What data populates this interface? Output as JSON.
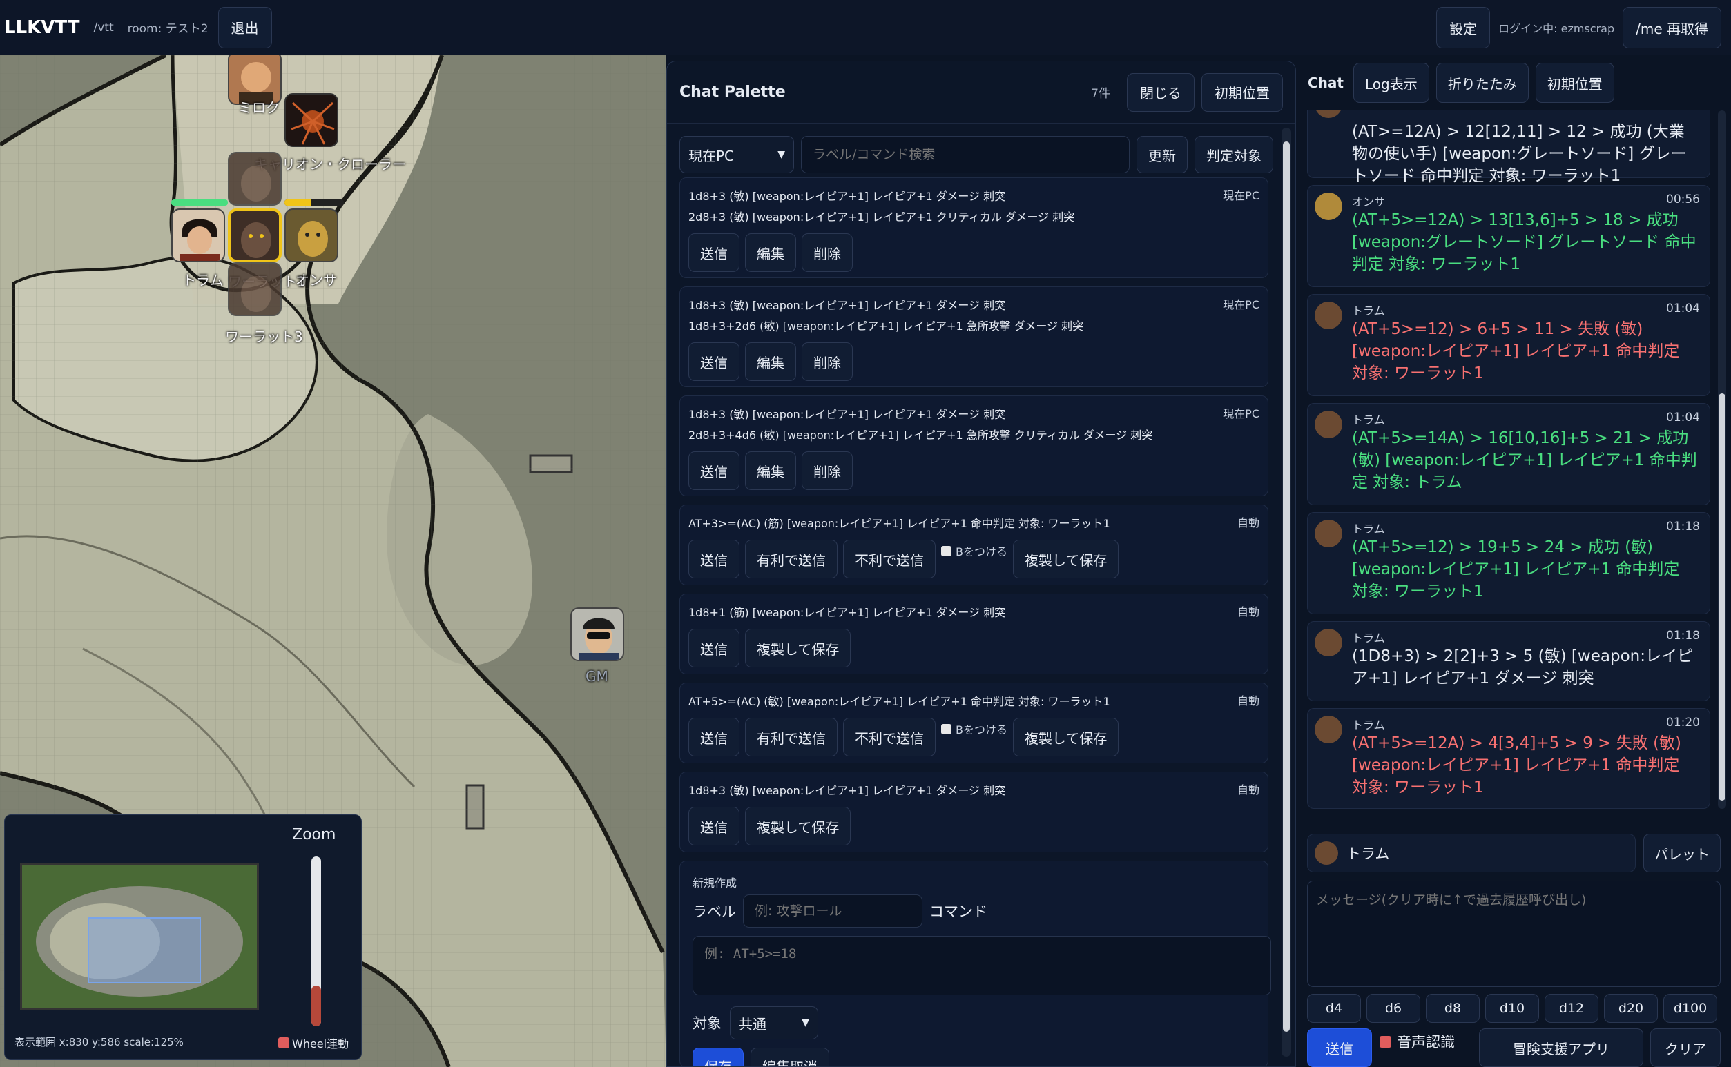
{
  "topbar": {
    "app_title": "LLKVTT",
    "path": "/vtt",
    "room": "room: テスト2",
    "logout": "退出",
    "settings": "設定",
    "login_status": "ログイン中: ezmscrap",
    "me_refresh": "/me 再取得"
  },
  "map": {
    "tokens": [
      {
        "name": "ミロク"
      },
      {
        "name": "キャリオン・クローラー"
      },
      {
        "name": "トラム"
      },
      {
        "name": "ワーラット1"
      },
      {
        "name": "オンサ"
      },
      {
        "name": "ワーラット3"
      },
      {
        "name": "GM"
      }
    ]
  },
  "minimap": {
    "zoom_label": "Zoom",
    "view_range": "表示範囲 x:830 y:586 scale:125%",
    "wheel_link": "Wheel連動",
    "zoom_level": 0.12
  },
  "palette": {
    "title": "Chat Palette",
    "count": "7件",
    "close": "閉じる",
    "reset_pos": "初期位置",
    "pc_select": "現在PC",
    "search_placeholder": "ラベル/コマンド検索",
    "refresh": "更新",
    "judge_target": "判定対象",
    "items": [
      {
        "line1": "1d8+3 (敏) [weapon:レイピア+1] レイピア+1 ダメージ 刺突",
        "line2": "2d8+3 (敏) [weapon:レイピア+1] レイピア+1 クリティカル ダメージ 刺突",
        "tag": "現在PC",
        "b1": "送信",
        "b2": "編集",
        "b3": "削除"
      },
      {
        "line1": "1d8+3 (敏) [weapon:レイピア+1] レイピア+1 ダメージ 刺突",
        "line2": "1d8+3+2d6 (敏) [weapon:レイピア+1] レイピア+1 急所攻撃 ダメージ 刺突",
        "tag": "現在PC",
        "b1": "送信",
        "b2": "編集",
        "b3": "削除"
      },
      {
        "line1": "1d8+3 (敏) [weapon:レイピア+1] レイピア+1 ダメージ 刺突",
        "line2": "2d8+3+4d6 (敏) [weapon:レイピア+1] レイピア+1 急所攻撃 クリティカル ダメージ 刺突",
        "tag": "現在PC",
        "b1": "送信",
        "b2": "編集",
        "b3": "削除"
      },
      {
        "line1": "AT+3>=(AC) (筋) [weapon:レイピア+1] レイピア+1 命中判定 対象: ワーラット1",
        "tag": "自動",
        "b1": "送信",
        "b2": "有利で送信",
        "b3": "不利で送信",
        "chk": "Bをつける",
        "b4": "複製して保存"
      },
      {
        "line1": "1d8+1 (筋) [weapon:レイピア+1] レイピア+1 ダメージ 刺突",
        "tag": "自動",
        "b1": "送信",
        "b2": "複製して保存"
      },
      {
        "line1": "AT+5>=(AC) (敏) [weapon:レイピア+1] レイピア+1 命中判定 対象: ワーラット1",
        "tag": "自動",
        "b1": "送信",
        "b2": "有利で送信",
        "b3": "不利で送信",
        "chk": "Bをつける",
        "b4": "複製して保存"
      },
      {
        "line1": "1d8+3 (敏) [weapon:レイピア+1] レイピア+1 ダメージ 刺突",
        "tag": "自動",
        "b1": "送信",
        "b2": "複製して保存"
      }
    ],
    "new_section": {
      "heading": "新規作成",
      "label_label": "ラベル",
      "label_placeholder": "例: 攻撃ロール",
      "command_label": "コマンド",
      "command_placeholder": "例: AT+5>=18",
      "target_label": "対象",
      "target_value": "共通",
      "save": "保存",
      "cancel": "編集取消"
    }
  },
  "chat": {
    "tabs": [
      "Chat",
      "Log表示",
      "折りたたみ",
      "初期位置"
    ],
    "messages": [
      {
        "name": "",
        "time": "",
        "text": "(AT>=12A) > 12[12,11] > 12 > 成功 (大業物の使い手) [weapon:グレートソード] グレートソード 命中判定 対象: ワーラット1",
        "kind": "nt"
      },
      {
        "name": "オンサ",
        "time": "00:56",
        "text": "(AT+5>=12A) > 13[13,6]+5 > 18 > 成功 [weapon:グレートソード] グレートソード 命中判定 対象: ワーラット1",
        "kind": "ok"
      },
      {
        "name": "トラム",
        "time": "01:04",
        "text": "(AT+5>=12) > 6+5 > 11 > 失敗 (敏) [weapon:レイピア+1] レイピア+1 命中判定 対象: ワーラット1",
        "kind": "ng"
      },
      {
        "name": "トラム",
        "time": "01:04",
        "text": "(AT+5>=14A) > 16[10,16]+5 > 21 > 成功 (敏) [weapon:レイピア+1] レイピア+1 命中判定 対象: トラム",
        "kind": "ok"
      },
      {
        "name": "トラム",
        "time": "01:18",
        "text": "(AT+5>=12) > 19+5 > 24 > 成功 (敏) [weapon:レイピア+1] レイピア+1 命中判定 対象: ワーラット1",
        "kind": "ok"
      },
      {
        "name": "トラム",
        "time": "01:18",
        "text": "(1D8+3) > 2[2]+3 > 5 (敏) [weapon:レイピア+1] レイピア+1 ダメージ 刺突",
        "kind": "nt"
      },
      {
        "name": "トラム",
        "time": "01:20",
        "text": "(AT+5>=12A) > 4[3,4]+5 > 9 > 失敗 (敏) [weapon:レイピア+1] レイピア+1 命中判定 対象: ワーラット1",
        "kind": "ng"
      }
    ],
    "speaker": "トラム",
    "palette_btn": "パレット",
    "message_placeholder": "メッセージ(クリア時に↑で過去履歴呼び出し)",
    "dice": [
      "d4",
      "d6",
      "d8",
      "d10",
      "d12",
      "d20",
      "d100"
    ],
    "send": "送信",
    "voice": "音声認識",
    "adventure_app": "冒険支援アプリ",
    "clear": "クリア"
  },
  "colors": {
    "success": "#4ade80",
    "failure": "#f87171",
    "selected_token": "#f0c419",
    "primary": "#1d4ed8"
  }
}
